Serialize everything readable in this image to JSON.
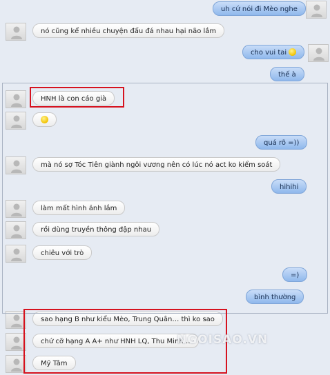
{
  "messages": [
    {
      "dir": "out",
      "text": "uh cứ nói đi Mèo nghe",
      "avatar": true
    },
    {
      "dir": "in",
      "text": "nó cũng kể nhiều chuyện đấu đá nhau hại não lắm",
      "avatar": true
    },
    {
      "dir": "out",
      "text": "cho vui tai",
      "emoji": "smiley-icon",
      "avatar": true
    },
    {
      "dir": "out",
      "text": "thế à",
      "avatar": false
    },
    {
      "dir": "in",
      "text": "HNH là con cáo già",
      "avatar": true
    },
    {
      "dir": "in",
      "text": "",
      "emoji": "smiley-icon",
      "avatar": true
    },
    {
      "dir": "out",
      "text": "quá rõ =))",
      "avatar": false
    },
    {
      "dir": "in",
      "text": "mà nó sợ Tóc Tiên giành ngôi vương nên có lúc nó act ko kiểm soát",
      "avatar": true
    },
    {
      "dir": "out",
      "text": "hihihi",
      "avatar": false
    },
    {
      "dir": "in",
      "text": "làm mất hình ảnh lắm",
      "avatar": true
    },
    {
      "dir": "in",
      "text": "rồi dùng truyền thông đập nhau",
      "avatar": true
    },
    {
      "dir": "in",
      "text": "chiêu với trò",
      "avatar": true
    },
    {
      "dir": "out",
      "text": "=)",
      "avatar": false
    },
    {
      "dir": "out",
      "text": "bình thường",
      "avatar": false
    },
    {
      "dir": "in",
      "text": "sao hạng B như kiểu Mèo, Trung Quân… thì ko sao",
      "avatar": true
    },
    {
      "dir": "in",
      "text": "chứ cỡ hạng A A+ như HNH LQ, Thu Minh…",
      "avatar": true
    },
    {
      "dir": "in",
      "text": "Mỹ Tâm",
      "avatar": true
    }
  ],
  "watermark": "NGOISAO.VN",
  "colors": {
    "background": "#e6ebf3",
    "incoming_bubble": "#ffffff",
    "outgoing_bubble": "#9fc2ee",
    "highlight_border": "#d6121e"
  }
}
